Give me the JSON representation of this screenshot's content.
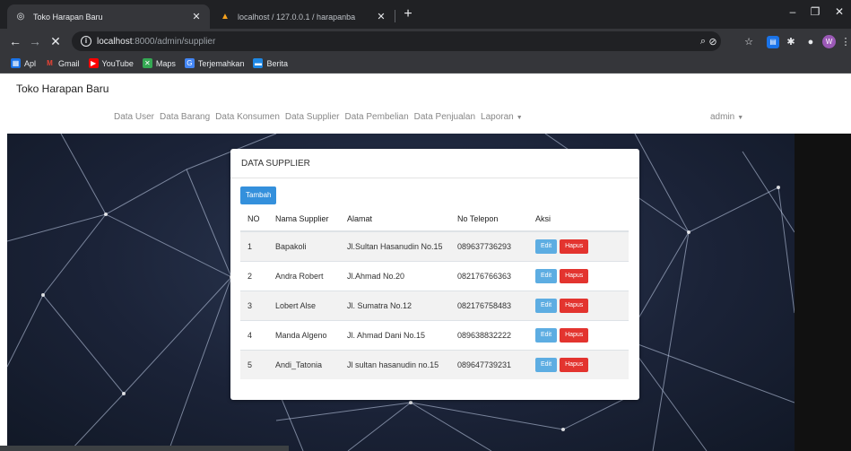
{
  "browser": {
    "tabs": [
      {
        "title": "Toko Harapan Baru",
        "active": true
      },
      {
        "title": "localhost / 127.0.0.1 / harapanba",
        "active": false
      }
    ],
    "url_host": "localhost",
    "url_path": ":8000/admin/supplier",
    "bookmarks": [
      {
        "label": "Apl",
        "icon": "apps-grid-icon"
      },
      {
        "label": "Gmail",
        "icon": "gmail-icon"
      },
      {
        "label": "YouTube",
        "icon": "youtube-icon"
      },
      {
        "label": "Maps",
        "icon": "maps-icon"
      },
      {
        "label": "Terjemahkan",
        "icon": "translate-icon"
      },
      {
        "label": "Berita",
        "icon": "news-icon"
      }
    ],
    "profile_initial": "W"
  },
  "site": {
    "brand": "Toko Harapan Baru",
    "nav": [
      "Data User",
      "Data Barang",
      "Data Konsumen",
      "Data Supplier",
      "Data Pembelian",
      "Data Penjualan",
      "Laporan"
    ],
    "user": "admin"
  },
  "card": {
    "title": "DATA SUPPLIER",
    "add_label": "Tambah",
    "columns": [
      "NO",
      "Nama Supplier",
      "Alamat",
      "No Telepon",
      "Aksi"
    ],
    "edit_label": "Edit",
    "delete_label": "Hapus",
    "rows": [
      {
        "no": "1",
        "nama": "Bapakoli",
        "alamat": "Jl.Sultan Hasanudin No.15",
        "telepon": "089637736293"
      },
      {
        "no": "2",
        "nama": "Andra Robert",
        "alamat": "Jl.Ahmad No.20",
        "telepon": "082176766363"
      },
      {
        "no": "3",
        "nama": "Lobert Alse",
        "alamat": "Jl. Sumatra No.12",
        "telepon": "082176758483"
      },
      {
        "no": "4",
        "nama": "Manda Algeno",
        "alamat": "Jl. Ahmad Dani No.15",
        "telepon": "089638832222"
      },
      {
        "no": "5",
        "nama": "Andi_Tatonia",
        "alamat": "Jl sultan hasanudin no.15",
        "telepon": "089647739231"
      }
    ]
  },
  "colors": {
    "primary": "#3490dc",
    "edit": "#5dade2",
    "danger": "#e3342f"
  }
}
